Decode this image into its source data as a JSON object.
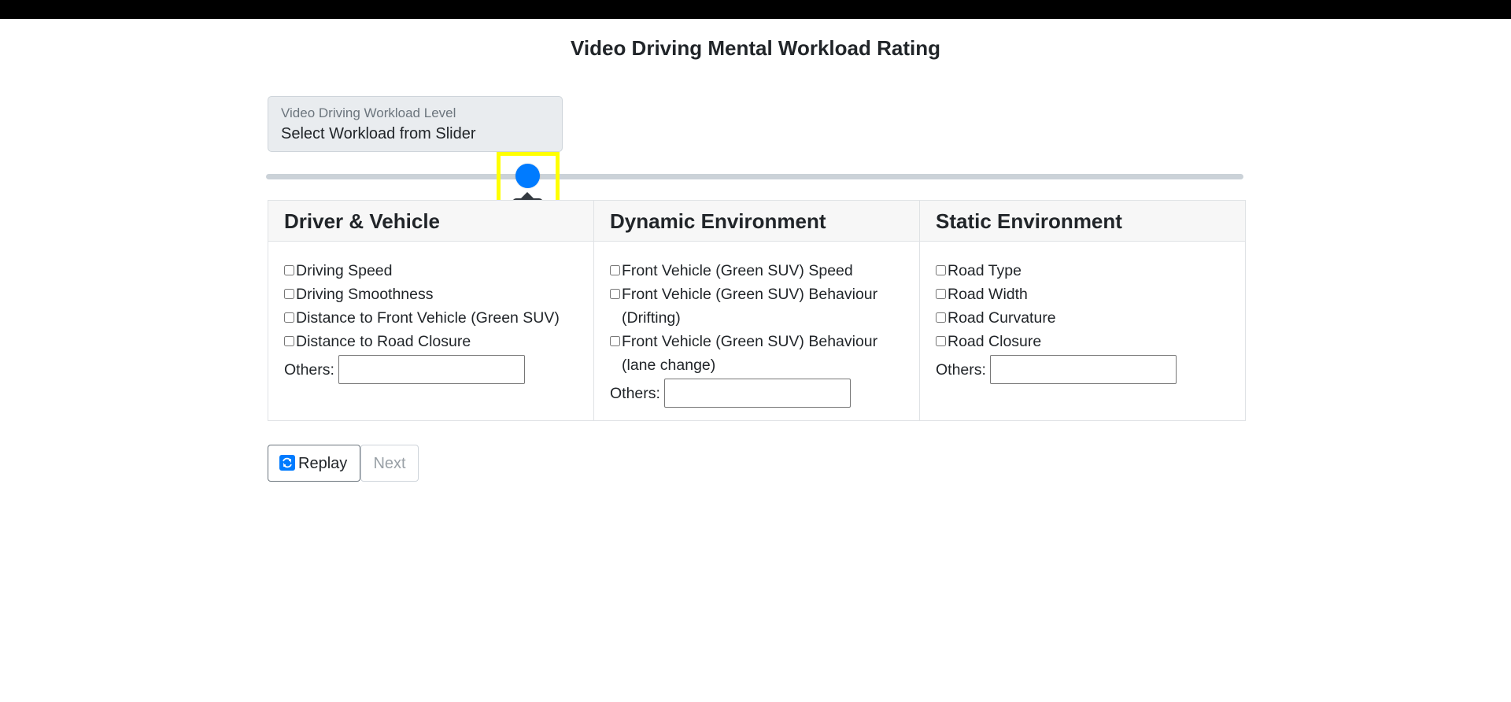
{
  "page": {
    "title": "Video Driving Mental Workload Rating"
  },
  "workload": {
    "label": "Video Driving Workload Level",
    "value": "Select Workload from Slider"
  },
  "slider": {
    "value": 40,
    "value_text": "40",
    "accent_color": "#007bff"
  },
  "cards": [
    {
      "title": "Driver & Vehicle",
      "items": [
        "Driving Speed",
        "Driving Smoothness",
        "Distance to Front Vehicle (Green SUV)",
        "Distance to Road Closure"
      ],
      "others_label": "Others:",
      "others_value": ""
    },
    {
      "title": "Dynamic Environment",
      "items": [
        "Front Vehicle (Green SUV) Speed",
        "Front Vehicle (Green SUV) Behaviour (Drifting)",
        "Front Vehicle (Green SUV) Behaviour (lane change)"
      ],
      "others_label": "Others:",
      "others_value": ""
    },
    {
      "title": "Static Environment",
      "items": [
        "Road Type",
        "Road Width",
        "Road Curvature",
        "Road Closure"
      ],
      "others_label": "Others:",
      "others_value": ""
    }
  ],
  "buttons": {
    "replay_label": "Replay",
    "replay_icon": "replay-icon",
    "next_label": "Next"
  }
}
